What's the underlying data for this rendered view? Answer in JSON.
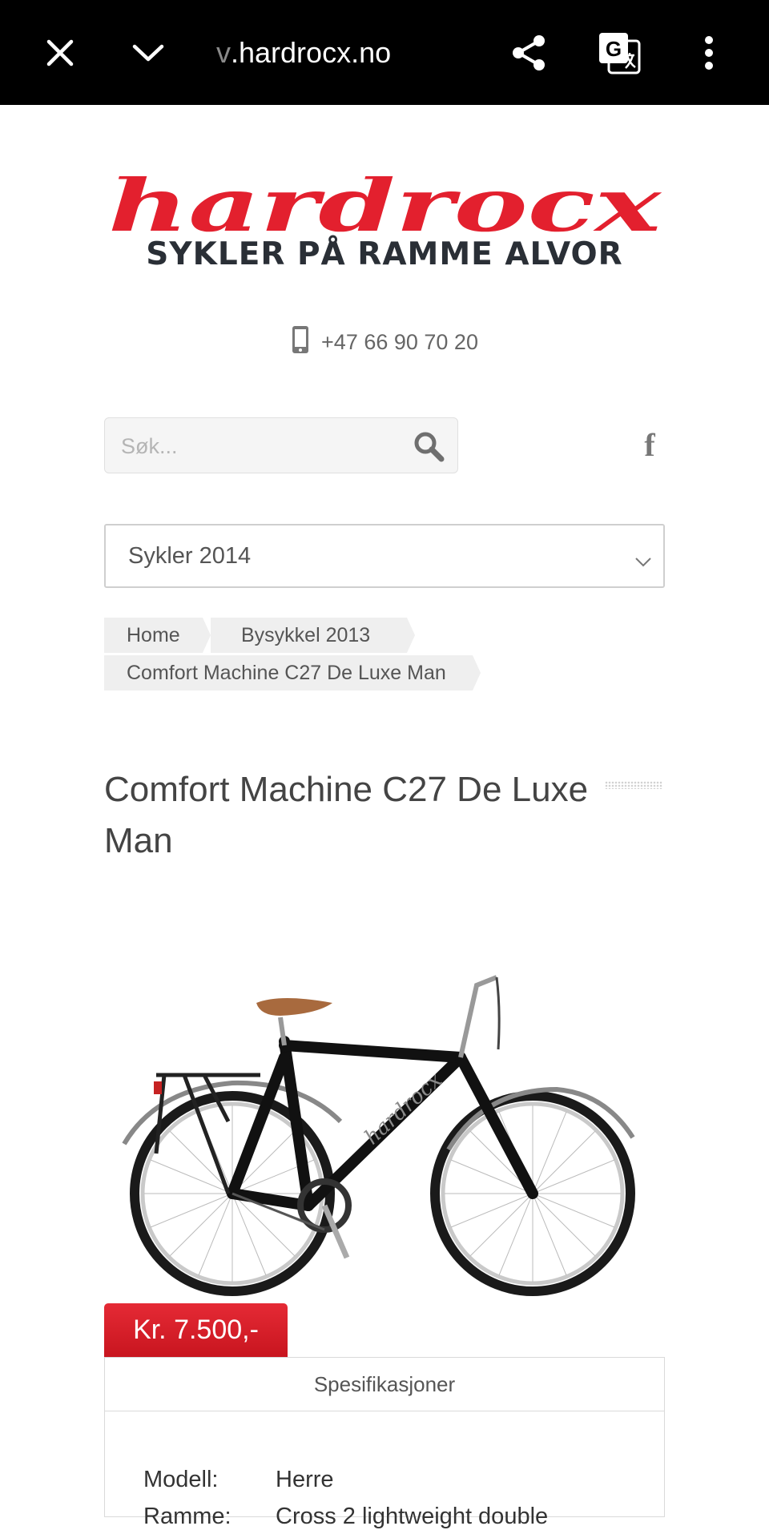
{
  "browser": {
    "url_faded": "v",
    "url_text": ".hardrocx.no"
  },
  "logo": {
    "wordmark": "hardrocx",
    "tagline": "SYKLER PÅ RAMME ALVOR",
    "brand_red": "#e3202e",
    "dark_text": "#2a2f36"
  },
  "contact": {
    "phone": "+47 66 90 70 20"
  },
  "search": {
    "placeholder": "Søk..."
  },
  "social": {
    "facebook_glyph": "f"
  },
  "category_select": {
    "selected": "Sykler 2014"
  },
  "breadcrumb": {
    "items": [
      "Home",
      "Bysykkel 2013",
      "Comfort Machine C27 De Luxe Man"
    ]
  },
  "product": {
    "title": "Comfort Machine C27 De Luxe Man",
    "price": "Kr. 7.500,-",
    "price_color": "#d81e28"
  },
  "specs": {
    "heading": "Spesifikasjoner",
    "rows": [
      {
        "key": "Modell:",
        "value": "Herre"
      },
      {
        "key": "Ramme:",
        "value": "Cross 2 lightweight double"
      }
    ]
  }
}
